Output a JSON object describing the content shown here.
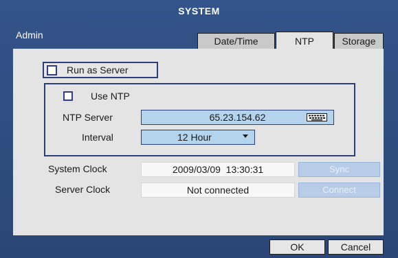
{
  "window": {
    "title": "SYSTEM",
    "user": "Admin"
  },
  "tabs": [
    {
      "label": "Date/Time",
      "active": false
    },
    {
      "label": "NTP",
      "active": true
    },
    {
      "label": "Storage",
      "active": false
    }
  ],
  "ntp": {
    "run_as_server": {
      "label": "Run as Server",
      "checked": false
    },
    "use_ntp": {
      "label": "Use NTP",
      "checked": false
    },
    "ntp_server": {
      "label": "NTP Server",
      "value": "65.23.154.62",
      "icon": "keyboard-icon"
    },
    "interval": {
      "label": "Interval",
      "value": "12 Hour",
      "icon": "dropdown-arrow-icon"
    }
  },
  "clocks": {
    "system": {
      "label": "System Clock",
      "value": "2009/03/09  13:30:31",
      "button": "Sync"
    },
    "server": {
      "label": "Server Clock",
      "value": "Not connected",
      "button": "Connect"
    }
  },
  "footer": {
    "ok_label": "OK",
    "cancel_label": "Cancel"
  },
  "colors": {
    "window_bg": "#2c4a7a",
    "panel_bg": "#e4e4e4",
    "field_blue": "#b3d4ec",
    "frame_border": "#2a3e7a",
    "disabled_button": "#b7cce6"
  }
}
